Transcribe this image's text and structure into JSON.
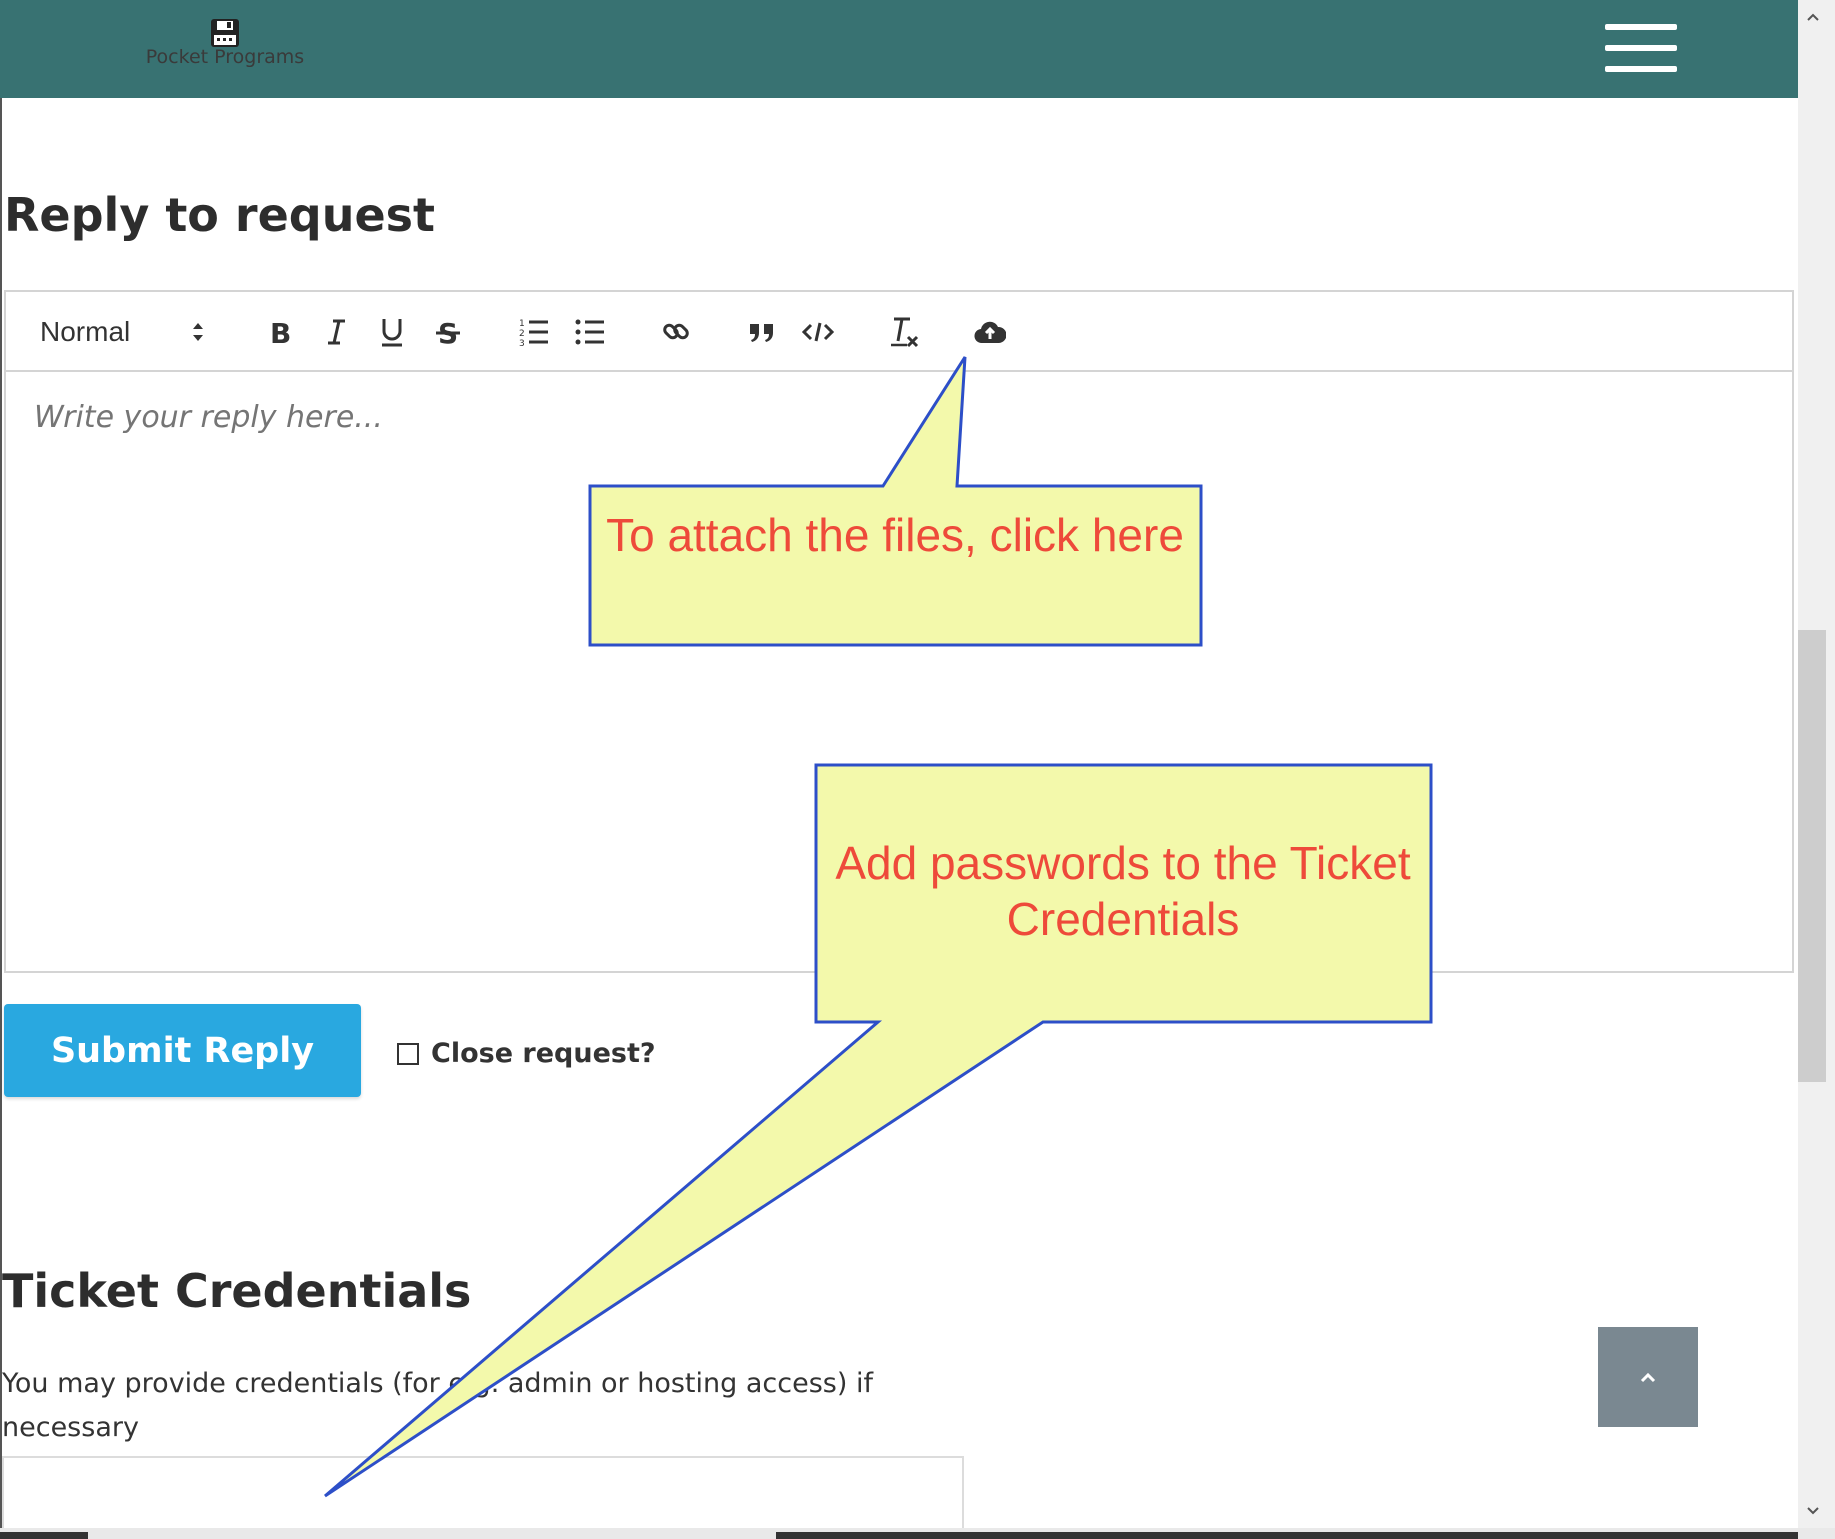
{
  "header": {
    "brand": "Pocket Programs",
    "logo_icon": "floppy-disk-icon",
    "menu_icon": "hamburger-menu-icon"
  },
  "reply": {
    "title": "Reply to request",
    "format_select": "Normal",
    "placeholder": "Write your reply here...",
    "toolbar_icons": [
      "header-select-arrows-icon",
      "bold-icon",
      "italic-icon",
      "underline-icon",
      "strikethrough-icon",
      "ordered-list-icon",
      "bullet-list-icon",
      "link-icon",
      "blockquote-icon",
      "code-icon",
      "clear-format-icon",
      "cloud-upload-icon"
    ],
    "submit_label": "Submit Reply",
    "close_label": "Close request?"
  },
  "credentials": {
    "title": "Ticket Credentials",
    "description": "You may provide credentials (for e.g. admin or hosting access) if necessary"
  },
  "callouts": {
    "attach": "To attach the files, click here",
    "passwords": "Add passwords to the Ticket Credentials"
  },
  "colors": {
    "header_bg": "#387272",
    "submit_bg": "#29a8e0",
    "callout_fill": "#f3f9ab",
    "callout_border": "#2d4fc8",
    "callout_text": "#ee4a3a"
  }
}
